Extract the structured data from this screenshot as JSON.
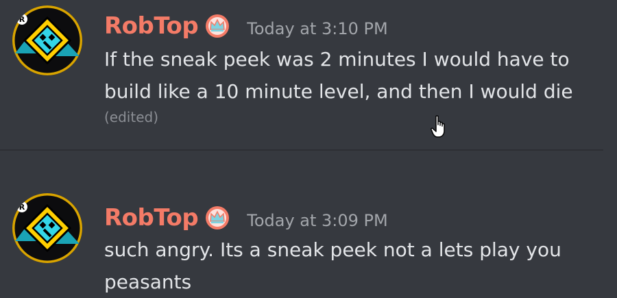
{
  "messages": [
    {
      "author": "RobTop",
      "avatar_icon": "geometry-dash-cube-icon",
      "badge_icon": "crown-icon",
      "timestamp": "Today at 3:10 PM",
      "text": "If the sneak peek was 2 minutes I would have to build like a 10 minute level, and then I would die",
      "edited_label": "(edited)"
    },
    {
      "author": "RobTop",
      "avatar_icon": "geometry-dash-cube-icon",
      "badge_icon": "crown-icon",
      "timestamp": "Today at 3:09 PM",
      "text": "such angry. Its a sneak peek not a lets play you peasants"
    }
  ],
  "colors": {
    "background": "#36393f",
    "author": "#f47b67",
    "text": "#e3e5e8",
    "timestamp": "#a3a6ab",
    "badge": "#f47b67",
    "badge_crown": "#7fd3e0",
    "cube_yellow": "#ffcf00",
    "cube_cyan": "#33d6e8"
  }
}
